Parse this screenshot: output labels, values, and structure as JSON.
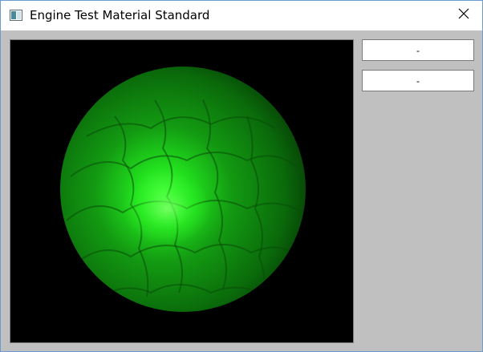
{
  "window": {
    "title": "Engine Test Material Standard"
  },
  "title_bar": {
    "close_glyph": "✕"
  },
  "controls": {
    "button_1_label": "-",
    "button_2_label": "-"
  },
  "colors": {
    "viewport_background": "#000000",
    "sphere_color": "#1ed41e",
    "client_background": "#c0c0c0",
    "window_border": "#6c9bd2"
  },
  "icons": {
    "app": "window-app-icon",
    "close": "close-icon"
  }
}
